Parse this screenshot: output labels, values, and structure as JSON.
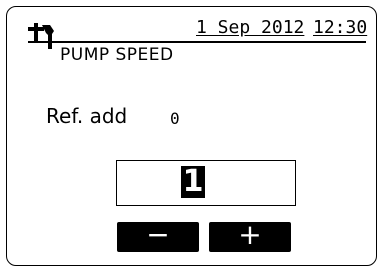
{
  "header": {
    "date": "1 Sep 2012",
    "time": "12:30",
    "service_icon": "service-tool-icon"
  },
  "screen": {
    "title": "PUMP SPEED"
  },
  "ref_address": {
    "label": "Ref. add",
    "value": "0"
  },
  "pump_speed": {
    "value": "1"
  },
  "buttons": {
    "minus_label": "−",
    "plus_label": "+"
  },
  "colors": {
    "background": "#ffffff",
    "foreground": "#000000"
  }
}
